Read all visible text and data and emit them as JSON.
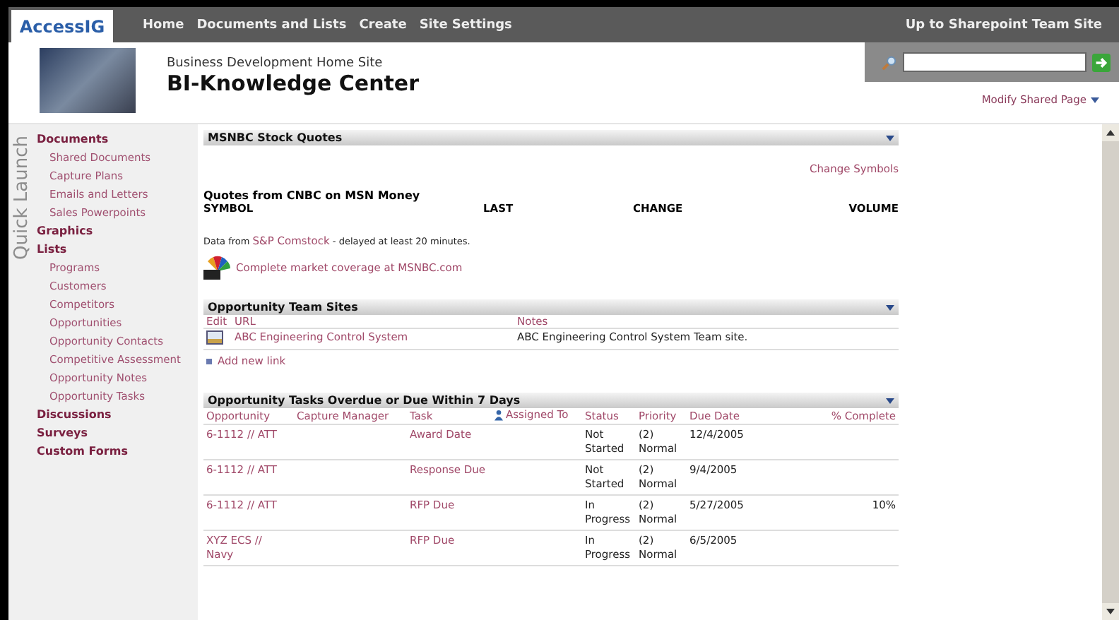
{
  "nav": {
    "logo": "AccessIG",
    "links": [
      "Home",
      "Documents and Lists",
      "Create",
      "Site Settings"
    ],
    "right_link": "Up to Sharepoint Team Site"
  },
  "header": {
    "subtitle": "Business Development Home Site",
    "title": "BI-Knowledge Center",
    "modify": "Modify Shared Page"
  },
  "sidebar": {
    "label": "Quick Launch",
    "items": [
      {
        "label": "Documents",
        "children": [
          {
            "label": "Shared Documents"
          },
          {
            "label": "Capture Plans"
          },
          {
            "label": "Emails and Letters"
          },
          {
            "label": "Sales Powerpoints"
          }
        ]
      },
      {
        "label": "Graphics"
      },
      {
        "label": "Lists",
        "children": [
          {
            "label": "Programs"
          },
          {
            "label": "Customers"
          },
          {
            "label": "Competitors"
          },
          {
            "label": "Opportunities"
          },
          {
            "label": "Opportunity Contacts"
          },
          {
            "label": "Competitive Assessment"
          },
          {
            "label": "Opportunity Notes"
          },
          {
            "label": "Opportunity Tasks"
          }
        ]
      },
      {
        "label": "Discussions"
      },
      {
        "label": "Surveys"
      },
      {
        "label": "Custom Forms"
      }
    ]
  },
  "stock": {
    "title": "MSNBC Stock Quotes",
    "change_link": "Change Symbols",
    "quotes_title": "Quotes from CNBC on MSN Money",
    "columns": [
      "SYMBOL",
      "LAST",
      "CHANGE",
      "VOLUME"
    ],
    "data_prefix": "Data from",
    "data_link": "S&P Comstock",
    "data_suffix": "- delayed at least 20 minutes.",
    "coverage_link": "Complete market coverage at MSNBC.com"
  },
  "team_sites": {
    "title": "Opportunity Team Sites",
    "columns": [
      "Edit",
      "URL",
      "Notes"
    ],
    "rows": [
      {
        "url": "ABC Engineering Control System",
        "notes": "ABC Engineering Control System Team site."
      }
    ],
    "add_link": "Add new link"
  },
  "tasks": {
    "title": "Opportunity Tasks Overdue or Due Within 7 Days",
    "columns": [
      "Opportunity",
      "Capture Manager",
      "Task",
      "Assigned To",
      "Status",
      "Priority",
      "Due Date",
      "% Complete"
    ],
    "rows": [
      [
        "6-1112 // ATT",
        "",
        "Award Date",
        "",
        "Not Started",
        "(2) Normal",
        "12/4/2005",
        ""
      ],
      [
        "6-1112 // ATT",
        "",
        "Response Due",
        "",
        "Not Started",
        "(2) Normal",
        "9/4/2005",
        ""
      ],
      [
        "6-1112 // ATT",
        "",
        "RFP Due",
        "",
        "In Progress",
        "(2) Normal",
        "5/27/2005",
        "10%"
      ],
      [
        "XYZ ECS // Navy",
        "",
        "RFP Due",
        "",
        "In Progress",
        "(2) Normal",
        "6/5/2005",
        ""
      ]
    ]
  }
}
